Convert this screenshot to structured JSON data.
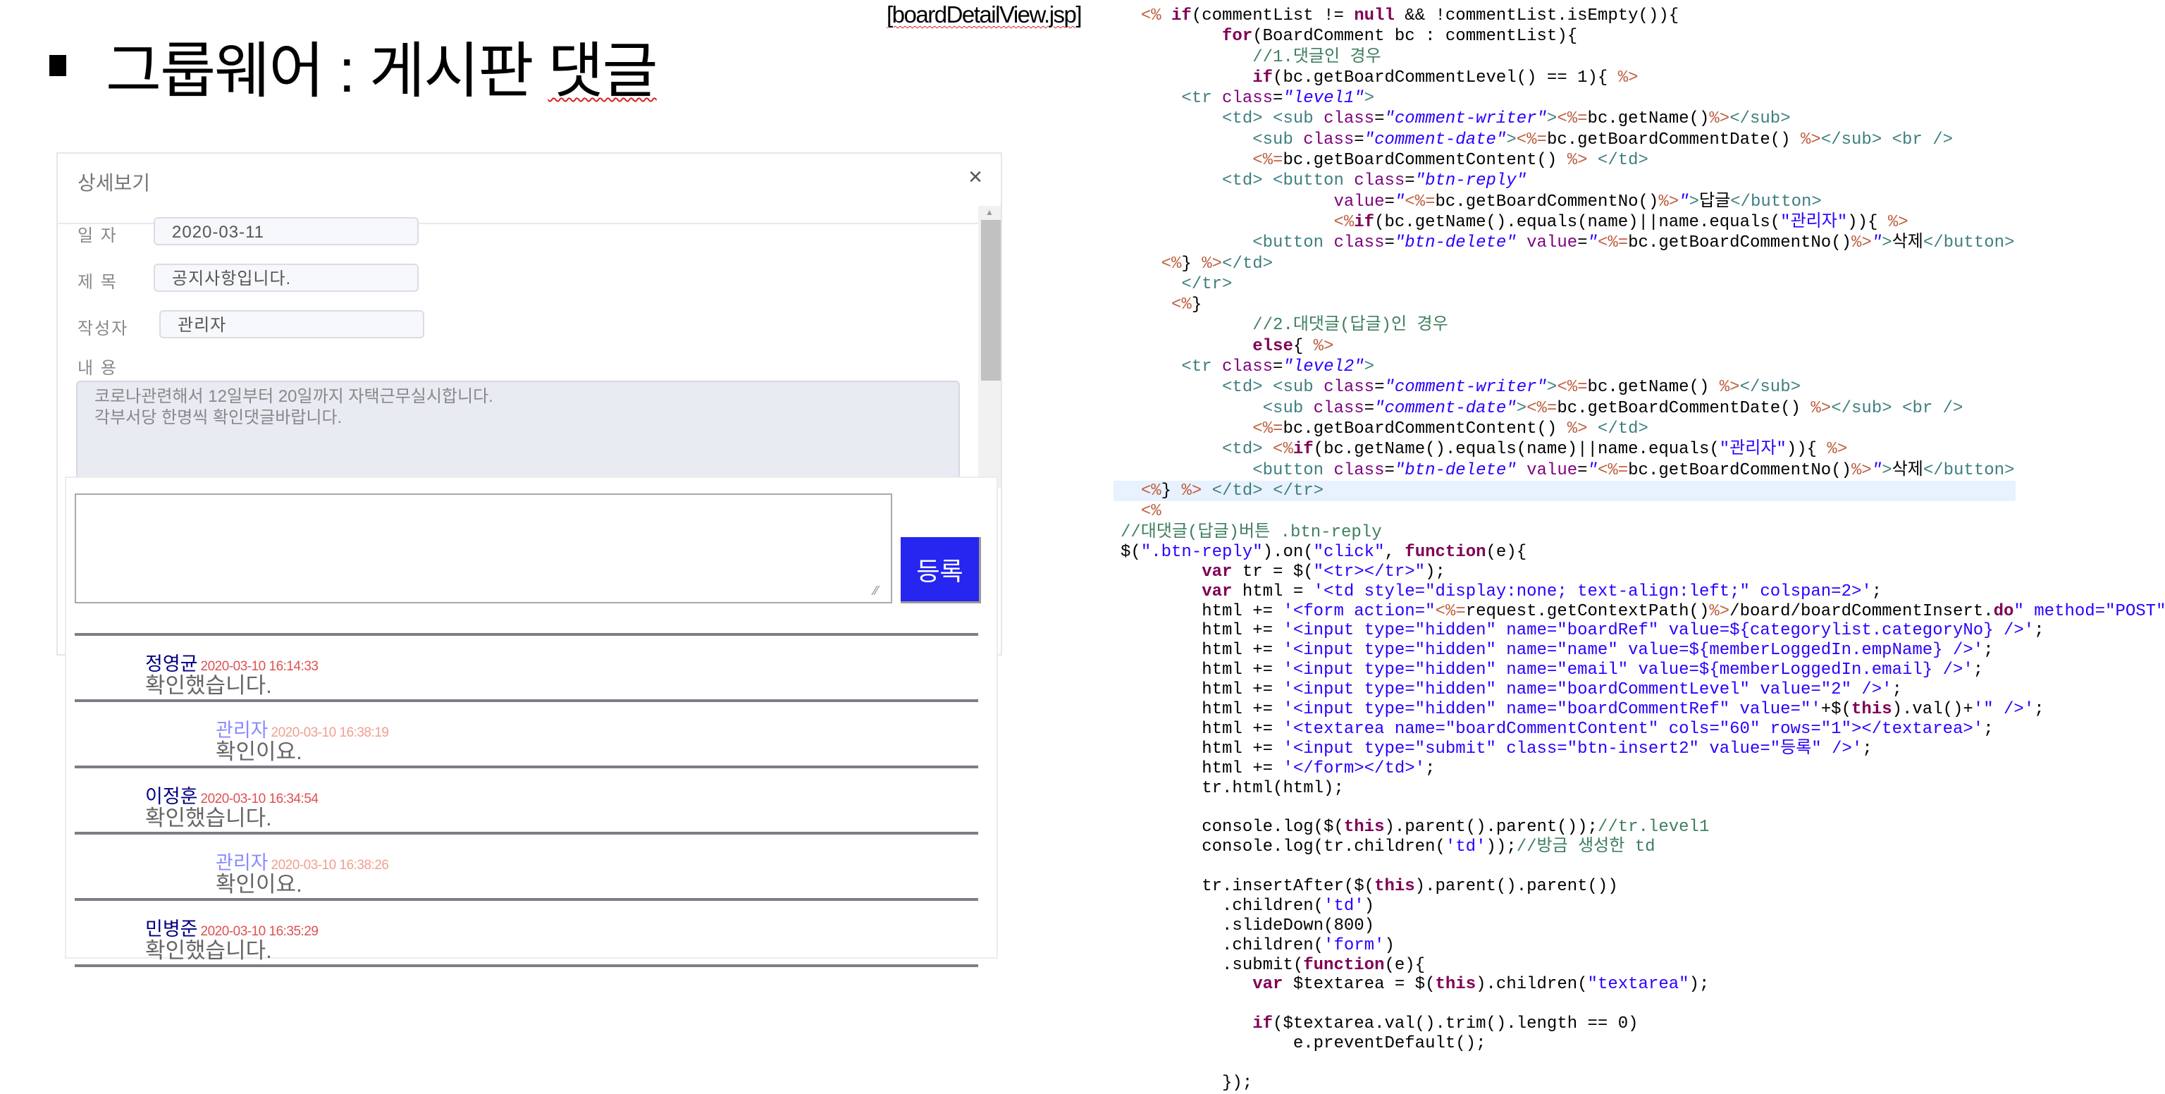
{
  "slide": {
    "title_main": "그룹웨어 : 게시판 ",
    "title_underlined": "댓글",
    "filename": "[boardDetailView.jsp]"
  },
  "modal": {
    "title": "상세보기",
    "close": "×",
    "fields": [
      {
        "label": "일 자",
        "value": "2020-03-11"
      },
      {
        "label": "제 목",
        "value": "공지사항입니다."
      },
      {
        "label": "작성자",
        "value": "관리자"
      }
    ],
    "content_label": "내 용",
    "content_lines": [
      "코로나관련해서 12일부터 20일까지 자택근무실시합니다.",
      "각부서당 한명씩 확인댓글바랍니다."
    ]
  },
  "comment_form": {
    "textarea_value": "",
    "submit_label": "등록"
  },
  "comments": [
    {
      "level": 1,
      "name": "정영균",
      "date": "2020-03-10 16:14:33",
      "content": "확인했습니다."
    },
    {
      "level": 2,
      "name": "관리자",
      "date": "2020-03-10 16:38:19",
      "content": "확인이요."
    },
    {
      "level": 1,
      "name": "이정훈",
      "date": "2020-03-10 16:34:54",
      "content": "확인했습니다."
    },
    {
      "level": 2,
      "name": "관리자",
      "date": "2020-03-10 16:38:26",
      "content": "확인이요."
    },
    {
      "level": 1,
      "name": "민병준",
      "date": "2020-03-10 16:35:29",
      "content": "확인했습니다."
    }
  ],
  "code": {
    "block_a": [
      [
        [
          "p",
          "  "
        ],
        [
          "j",
          "<%"
        ],
        [
          "p",
          " "
        ],
        [
          "k",
          "if"
        ],
        [
          "p",
          "(commentList != "
        ],
        [
          "k",
          "null"
        ],
        [
          "p",
          " && !commentList.isEmpty()){"
        ]
      ],
      [
        [
          "p",
          "          "
        ],
        [
          "k",
          "for"
        ],
        [
          "p",
          "(BoardComment bc : commentList){"
        ]
      ],
      [
        [
          "p",
          "             "
        ],
        [
          "c",
          "//1.댓글인 경우"
        ]
      ],
      [
        [
          "p",
          "             "
        ],
        [
          "k",
          "if"
        ],
        [
          "p",
          "(bc.getBoardCommentLevel() == 1){ "
        ],
        [
          "j",
          "%>"
        ]
      ],
      [
        [
          "p",
          "      "
        ],
        [
          "t",
          "<tr "
        ],
        [
          "a",
          "class"
        ],
        [
          "p",
          "="
        ],
        [
          "s",
          "\"level1\""
        ],
        [
          "t",
          ">"
        ]
      ],
      [
        [
          "p",
          "          "
        ],
        [
          "t",
          "<td> <sub "
        ],
        [
          "a",
          "class"
        ],
        [
          "p",
          "="
        ],
        [
          "s",
          "\"comment-writer\""
        ],
        [
          "t",
          ">"
        ],
        [
          "j",
          "<%="
        ],
        [
          "p",
          "bc.getName()"
        ],
        [
          "j",
          "%>"
        ],
        [
          "t",
          "</sub>"
        ]
      ],
      [
        [
          "p",
          "             "
        ],
        [
          "t",
          "<sub "
        ],
        [
          "a",
          "class"
        ],
        [
          "p",
          "="
        ],
        [
          "s",
          "\"comment-date\""
        ],
        [
          "t",
          ">"
        ],
        [
          "j",
          "<%="
        ],
        [
          "p",
          "bc.getBoardCommentDate() "
        ],
        [
          "j",
          "%>"
        ],
        [
          "t",
          "</sub> <br />"
        ]
      ],
      [
        [
          "p",
          "             "
        ],
        [
          "j",
          "<%="
        ],
        [
          "p",
          "bc.getBoardCommentContent() "
        ],
        [
          "j",
          "%>"
        ],
        [
          "t",
          " </td>"
        ]
      ],
      [
        [
          "p",
          "          "
        ],
        [
          "t",
          "<td> <button "
        ],
        [
          "a",
          "class"
        ],
        [
          "p",
          "="
        ],
        [
          "s",
          "\"btn-reply\""
        ]
      ],
      [
        [
          "p",
          "                     "
        ],
        [
          "a",
          "value"
        ],
        [
          "p",
          "="
        ],
        [
          "s",
          "\""
        ],
        [
          "j",
          "<%="
        ],
        [
          "p",
          "bc.getBoardCommentNo()"
        ],
        [
          "j",
          "%>"
        ],
        [
          "s",
          "\""
        ],
        [
          "t",
          ">"
        ],
        [
          "p",
          "답글"
        ],
        [
          "t",
          "</button>"
        ]
      ],
      [
        [
          "p",
          "                     "
        ],
        [
          "j",
          "<%"
        ],
        [
          "k",
          "if"
        ],
        [
          "p",
          "(bc.getName().equals(name)||name.equals("
        ],
        [
          "q",
          "\"관리자\""
        ],
        [
          "p",
          ")){ "
        ],
        [
          "j",
          "%>"
        ]
      ],
      [
        [
          "p",
          "             "
        ],
        [
          "t",
          "<button "
        ],
        [
          "a",
          "class"
        ],
        [
          "p",
          "="
        ],
        [
          "s",
          "\"btn-delete\""
        ],
        [
          "p",
          " "
        ],
        [
          "a",
          "value"
        ],
        [
          "p",
          "="
        ],
        [
          "s",
          "\""
        ],
        [
          "j",
          "<%="
        ],
        [
          "p",
          "bc.getBoardCommentNo()"
        ],
        [
          "j",
          "%>"
        ],
        [
          "s",
          "\""
        ],
        [
          "t",
          ">"
        ],
        [
          "p",
          "삭제"
        ],
        [
          "t",
          "</button>"
        ]
      ],
      [
        [
          "p",
          "    "
        ],
        [
          "j",
          "<%"
        ],
        [
          "p",
          "} "
        ],
        [
          "j",
          "%>"
        ],
        [
          "t",
          "</td>"
        ]
      ],
      [
        [
          "p",
          "      "
        ],
        [
          "t",
          "</tr>"
        ]
      ],
      [
        [
          "p",
          "     "
        ],
        [
          "j",
          "<%"
        ],
        [
          "p",
          "}"
        ]
      ],
      [
        [
          "p",
          "             "
        ],
        [
          "c",
          "//2.대댓글(답글)인 경우"
        ]
      ],
      [
        [
          "p",
          "             "
        ],
        [
          "k",
          "else"
        ],
        [
          "p",
          "{ "
        ],
        [
          "j",
          "%>"
        ]
      ],
      [
        [
          "p",
          "      "
        ],
        [
          "t",
          "<tr "
        ],
        [
          "a",
          "class"
        ],
        [
          "p",
          "="
        ],
        [
          "s",
          "\"level2\""
        ],
        [
          "t",
          ">"
        ]
      ],
      [
        [
          "p",
          "          "
        ],
        [
          "t",
          "<td> <sub "
        ],
        [
          "a",
          "class"
        ],
        [
          "p",
          "="
        ],
        [
          "s",
          "\"comment-writer\""
        ],
        [
          "t",
          ">"
        ],
        [
          "j",
          "<%="
        ],
        [
          "p",
          "bc.getName() "
        ],
        [
          "j",
          "%>"
        ],
        [
          "t",
          "</sub>"
        ]
      ],
      [
        [
          "p",
          "              "
        ],
        [
          "t",
          "<sub "
        ],
        [
          "a",
          "class"
        ],
        [
          "p",
          "="
        ],
        [
          "s",
          "\"comment-date\""
        ],
        [
          "t",
          ">"
        ],
        [
          "j",
          "<%="
        ],
        [
          "p",
          "bc.getBoardCommentDate() "
        ],
        [
          "j",
          "%>"
        ],
        [
          "t",
          "</sub> <br />"
        ]
      ],
      [
        [
          "p",
          "             "
        ],
        [
          "j",
          "<%="
        ],
        [
          "p",
          "bc.getBoardCommentContent() "
        ],
        [
          "j",
          "%>"
        ],
        [
          "t",
          " </td>"
        ]
      ],
      [
        [
          "p",
          "          "
        ],
        [
          "t",
          "<td> "
        ],
        [
          "j",
          "<%"
        ],
        [
          "k",
          "if"
        ],
        [
          "p",
          "(bc.getName().equals(name)||name.equals("
        ],
        [
          "q",
          "\"관리자\""
        ],
        [
          "p",
          ")){ "
        ],
        [
          "j",
          "%>"
        ]
      ],
      [
        [
          "p",
          "             "
        ],
        [
          "t",
          "<button "
        ],
        [
          "a",
          "class"
        ],
        [
          "p",
          "="
        ],
        [
          "s",
          "\"btn-delete\""
        ],
        [
          "p",
          " "
        ],
        [
          "a",
          "value"
        ],
        [
          "p",
          "="
        ],
        [
          "s",
          "\""
        ],
        [
          "j",
          "<%="
        ],
        [
          "p",
          "bc.getBoardCommentNo()"
        ],
        [
          "j",
          "%>"
        ],
        [
          "s",
          "\""
        ],
        [
          "t",
          ">"
        ],
        [
          "p",
          "삭제"
        ],
        [
          "t",
          "</button>"
        ]
      ],
      [
        [
          "p",
          "  "
        ],
        [
          "j",
          "<%"
        ],
        [
          "p",
          "} "
        ],
        [
          "j",
          "%>"
        ],
        [
          "t",
          " </td> </tr>"
        ]
      ],
      [
        [
          "p",
          "  "
        ],
        [
          "j",
          "<%"
        ]
      ]
    ],
    "block_b": [
      [
        [
          "c",
          "//대댓글(답글)버튼 .btn-reply"
        ]
      ],
      [
        [
          "p",
          "$("
        ],
        [
          "q",
          "\".btn-reply\""
        ],
        [
          "p",
          ").on("
        ],
        [
          "q",
          "\"click\""
        ],
        [
          "p",
          ", "
        ],
        [
          "k",
          "function"
        ],
        [
          "p",
          "(e){"
        ]
      ],
      [
        [
          "p",
          "        "
        ],
        [
          "k",
          "var"
        ],
        [
          "p",
          " tr = $("
        ],
        [
          "q",
          "\"<tr></tr>\""
        ],
        [
          "p",
          ");"
        ]
      ],
      [
        [
          "p",
          "        "
        ],
        [
          "k",
          "var"
        ],
        [
          "p",
          " html = "
        ],
        [
          "q",
          "'<td style=\"display:none; text-align:left;\" colspan=2>'"
        ],
        [
          "p",
          ";"
        ]
      ],
      [
        [
          "p",
          "        html += "
        ],
        [
          "q",
          "'<form action=\""
        ],
        [
          "j",
          "<%="
        ],
        [
          "p",
          "request.getContextPath()"
        ],
        [
          "j",
          "%>"
        ],
        [
          "p",
          "/board/boardCommentInsert."
        ],
        [
          "k",
          "do"
        ],
        [
          "q",
          "\" method=\"POST\">'"
        ],
        [
          "p",
          ";"
        ]
      ],
      [
        [
          "p",
          "        html += "
        ],
        [
          "q",
          "'<input type=\"hidden\" name=\"boardRef\" value=${categorylist.categoryNo} />'"
        ],
        [
          "p",
          ";"
        ]
      ],
      [
        [
          "p",
          "        html += "
        ],
        [
          "q",
          "'<input type=\"hidden\" name=\"name\" value=${memberLoggedIn.empName} />'"
        ],
        [
          "p",
          ";"
        ]
      ],
      [
        [
          "p",
          "        html += "
        ],
        [
          "q",
          "'<input type=\"hidden\" name=\"email\" value=${memberLoggedIn.email} />'"
        ],
        [
          "p",
          ";"
        ]
      ],
      [
        [
          "p",
          "        html += "
        ],
        [
          "q",
          "'<input type=\"hidden\" name=\"boardCommentLevel\" value=\"2\" />'"
        ],
        [
          "p",
          ";"
        ]
      ],
      [
        [
          "p",
          "        html += "
        ],
        [
          "q",
          "'<input type=\"hidden\" name=\"boardCommentRef\" value=\"'"
        ],
        [
          "p",
          "+$("
        ],
        [
          "k",
          "this"
        ],
        [
          "p",
          ").val()+"
        ],
        [
          "q",
          "'\" />'"
        ],
        [
          "p",
          ";"
        ]
      ],
      [
        [
          "p",
          "        html += "
        ],
        [
          "q",
          "'<textarea name=\"boardCommentContent\" cols=\"60\" rows=\"1\"></textarea>'"
        ],
        [
          "p",
          ";"
        ]
      ],
      [
        [
          "p",
          "        html += "
        ],
        [
          "q",
          "'<input type=\"submit\" class=\"btn-insert2\" value=\"등록\" />'"
        ],
        [
          "p",
          ";"
        ]
      ],
      [
        [
          "p",
          "        html += "
        ],
        [
          "q",
          "'</form></td>'"
        ],
        [
          "p",
          ";"
        ]
      ],
      [
        [
          "p",
          "        tr.html(html);"
        ]
      ],
      [],
      [
        [
          "p",
          "        console.log($("
        ],
        [
          "k",
          "this"
        ],
        [
          "p",
          ").parent().parent());"
        ],
        [
          "c",
          "//tr.level1"
        ]
      ],
      [
        [
          "p",
          "        console.log(tr.children("
        ],
        [
          "q",
          "'td'"
        ],
        [
          "p",
          "));"
        ],
        [
          "c",
          "//방금 생성한 td"
        ]
      ],
      [],
      [
        [
          "p",
          "        tr.insertAfter($("
        ],
        [
          "k",
          "this"
        ],
        [
          "p",
          ").parent().parent())"
        ]
      ],
      [
        [
          "p",
          "          .children("
        ],
        [
          "q",
          "'td'"
        ],
        [
          "p",
          ")"
        ]
      ],
      [
        [
          "p",
          "          .slideDown(800)"
        ]
      ],
      [
        [
          "p",
          "          .children("
        ],
        [
          "q",
          "'form'"
        ],
        [
          "p",
          ")"
        ]
      ],
      [
        [
          "p",
          "          .submit("
        ],
        [
          "k",
          "function"
        ],
        [
          "p",
          "(e){"
        ]
      ],
      [
        [
          "p",
          "             "
        ],
        [
          "k",
          "var"
        ],
        [
          "p",
          " $textarea = $("
        ],
        [
          "k",
          "this"
        ],
        [
          "p",
          ").children("
        ],
        [
          "q",
          "\"textarea\""
        ],
        [
          "p",
          ");"
        ]
      ],
      [],
      [
        [
          "p",
          "             "
        ],
        [
          "k",
          "if"
        ],
        [
          "p",
          "($textarea.val().trim().length == 0)"
        ]
      ],
      [
        [
          "p",
          "                 e.preventDefault();"
        ]
      ],
      [],
      [
        [
          "p",
          "          });"
        ]
      ]
    ]
  }
}
